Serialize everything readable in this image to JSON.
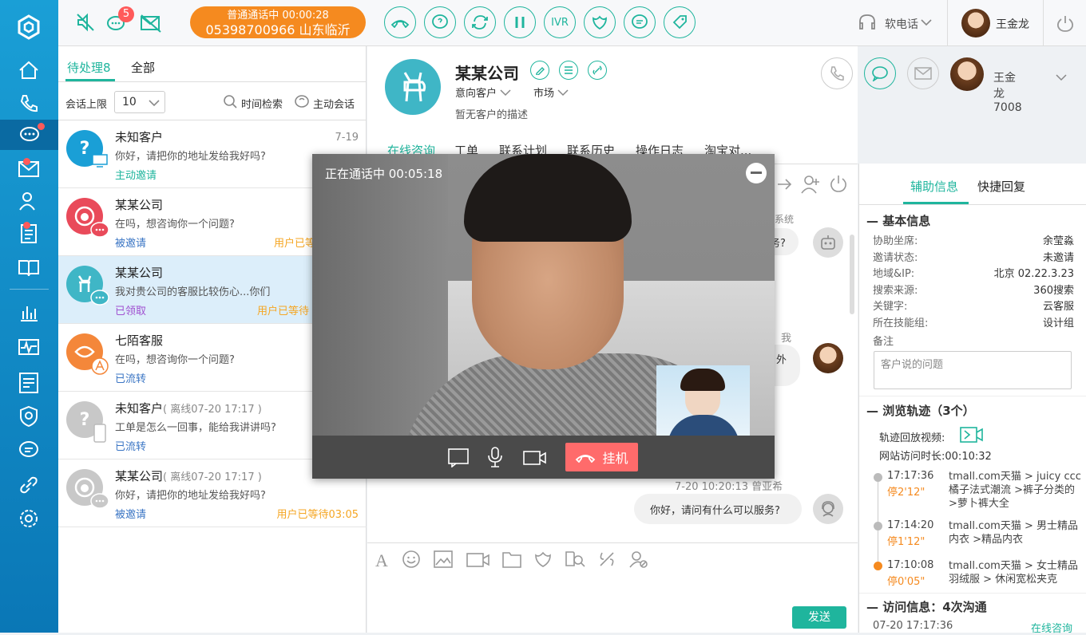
{
  "nav": {
    "icons": [
      "logo-icon",
      "home-icon",
      "phone-icon",
      "chat-icon",
      "mail-icon",
      "contacts-icon",
      "clipboard-icon",
      "book-icon",
      "bar-chart-icon",
      "monitor-icon",
      "checklist-icon",
      "shield-icon",
      "message-icon",
      "link-icon",
      "settings-icon"
    ]
  },
  "topbar": {
    "badge": "5",
    "call_status": "普通通话中 00:00:28",
    "call_number": "05398700966 山东临沂",
    "ivr": "IVR",
    "softphone": "软电话",
    "agent_name": "王金龙"
  },
  "list": {
    "tab_pending": "待处理8",
    "tab_all": "全部",
    "limit_label": "会话上限",
    "limit_value": "10",
    "time_search": "时间检索",
    "active_chat": "主动会话",
    "items": [
      {
        "name": "未知客户",
        "sub": "",
        "time": "7-19",
        "msg": "你好，请把你的地址发给我好吗?",
        "status": "主动邀请",
        "wait": ""
      },
      {
        "name": "某某公司",
        "sub": "",
        "time": "",
        "msg": "在吗，想咨询你一个问题?",
        "status": "被邀请",
        "wait": "用户已等"
      },
      {
        "name": "某某公司",
        "sub": "",
        "time": "",
        "msg": "我对贵公司的客服比较伤心...你们",
        "status": "已领取",
        "wait": "用户已等待"
      },
      {
        "name": "七陌客服",
        "sub": "",
        "time": "",
        "msg": "在吗，想咨询你一个问题?",
        "status": "已流转",
        "wait": ""
      },
      {
        "name": "未知客户",
        "sub": "( 离线07-20  17:17 )",
        "time": "",
        "msg": "工单是怎么一回事，能给我讲讲吗?",
        "status": "已流转",
        "wait": ""
      },
      {
        "name": "某某公司",
        "sub": "( 离线07-20 17:17 )",
        "time": "",
        "msg": "你好，请把你的地址发给我好吗?",
        "status": "被邀请",
        "wait": "用户已等待03:05"
      }
    ]
  },
  "customer": {
    "name": "某某公司",
    "tag1": "意向客户",
    "tag2": "市场",
    "desc": "暂无客户的描述",
    "agent_account": "王金龙7008",
    "tabs": [
      "在线咨询",
      "工单",
      "联系计划",
      "联系历史",
      "操作日志",
      "淘宝对..."
    ]
  },
  "chat": {
    "sys": "系统",
    "q_frag": "务?",
    "me_frag": "我",
    "out_frag": "外",
    "msg_time": "7-20  10:20:13  曾亚希",
    "msg_text": "你好，请问有什么可以服务?",
    "send": "发送"
  },
  "video": {
    "status": "正在通话中  00:05:18",
    "hangup": "挂机"
  },
  "side": {
    "tab_aux": "辅助信息",
    "tab_quick": "快捷回复",
    "basic_title": "基本信息",
    "basic": [
      {
        "k": "协助坐席:",
        "v": "余莹淼"
      },
      {
        "k": "邀请状态:",
        "v": "未邀请"
      },
      {
        "k": "地域&IP:",
        "v": "北京  02.22.3.23"
      },
      {
        "k": "搜索来源:",
        "v": "360搜索"
      },
      {
        "k": "关键字:",
        "v": "云客服"
      },
      {
        "k": "所在技能组:",
        "v": "设计组"
      }
    ],
    "note_label": "备注",
    "note_text": "客户说的问题",
    "track_title": "浏览轨迹（3个）",
    "replay_label": "轨迹回放视频:",
    "duration_label": "网站访问时长:",
    "duration": "00:10:32",
    "track": [
      {
        "time": "17:17:36",
        "stay": "停2'12\"",
        "l1": "tmall.com天猫 > juicy ccc",
        "l2": "橘子法式潮流 >裤子分类的",
        "l3": ">萝卜裤大全"
      },
      {
        "time": "17:14:20",
        "stay": "停1'12\"",
        "l1": "tmall.com天猫 > 男士精品",
        "l2": "内衣 >精品内衣",
        "l3": ""
      },
      {
        "time": "17:10:08",
        "stay": "停0'05\"",
        "l1": "tmall.com天猫 > 女士精品",
        "l2": "羽绒服 > 休闲宽松夹克",
        "l3": ""
      }
    ],
    "visit_title": "访问信息：4次沟通",
    "visit_time": "07-20  17:17:36",
    "visit_type": "在线咨询"
  },
  "colors": {
    "accent": "#1fb59d",
    "orange": "#f58a1f",
    "nav": "#118ccb",
    "red": "#ff5a5a"
  }
}
